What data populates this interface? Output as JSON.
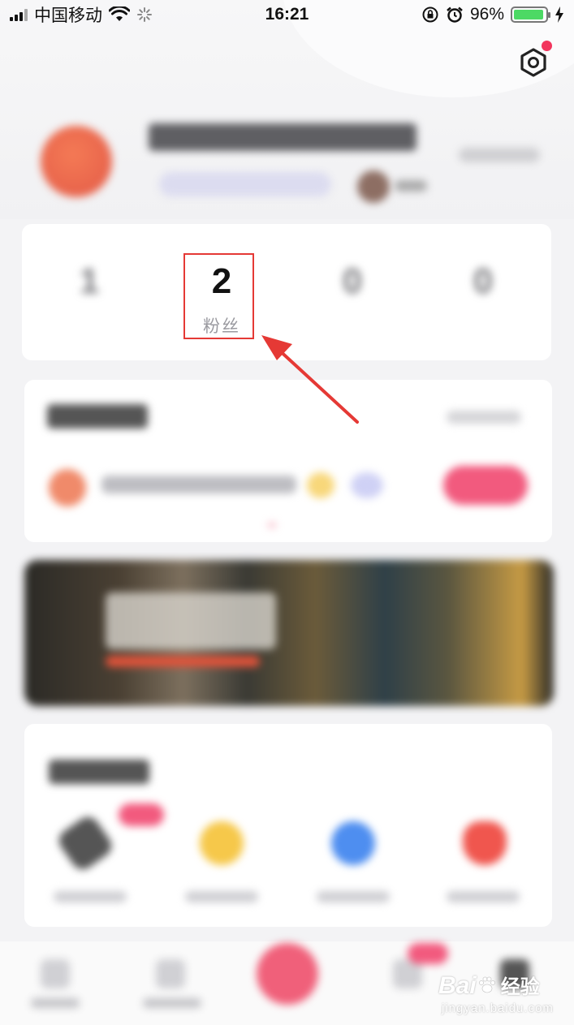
{
  "status_bar": {
    "carrier": "中国移动",
    "time": "16:21",
    "battery_percent": "96%",
    "battery_level": 0.96,
    "icons": [
      "signal-icon",
      "wifi-icon",
      "loading-icon",
      "rotation-lock-icon",
      "alarm-icon",
      "battery-icon",
      "charging-icon"
    ]
  },
  "header": {
    "settings_icon": "settings-hexagon-icon",
    "has_notification_dot": true
  },
  "stats": [
    {
      "value": "1",
      "label": "",
      "blurred": true
    },
    {
      "value": "2",
      "label": "粉丝",
      "blurred": false,
      "highlighted": true
    },
    {
      "value": "0",
      "label": "",
      "blurred": true
    },
    {
      "value": "0",
      "label": "",
      "blurred": true
    }
  ],
  "annotation": {
    "type": "arrow",
    "color": "#e53935",
    "target": "fans-stat"
  },
  "watermark": {
    "brand": "Bai",
    "brand_cn": "经验",
    "url": "jingyan.baidu.com"
  }
}
